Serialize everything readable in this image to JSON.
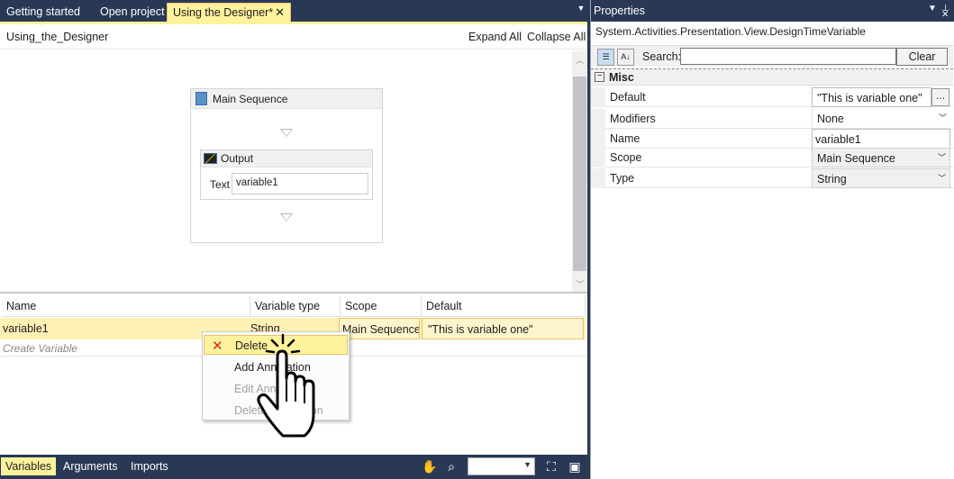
{
  "tabs": [
    {
      "label": "Getting started"
    },
    {
      "label": "Open project"
    },
    {
      "label": "Using the Designer*"
    }
  ],
  "designer": {
    "breadcrumb": "Using_the_Designer",
    "expand_all": "Expand All",
    "collapse_all": "Collapse All",
    "sequence_title": "Main Sequence",
    "output_title": "Output",
    "text_label": "Text",
    "text_value": "variable1"
  },
  "variables_grid": {
    "headers": [
      "Name",
      "Variable type",
      "Scope",
      "Default"
    ],
    "row": {
      "name": "variable1",
      "type": "String",
      "scope": "Main Sequence",
      "default": "\"This is variable one\""
    },
    "create_label": "Create Variable"
  },
  "context_menu": {
    "items": [
      "Delete",
      "Add Annotation",
      "Edit Annotation",
      "Delete Annotation"
    ]
  },
  "bottom_bar": {
    "tabs": [
      "Variables",
      "Arguments",
      "Imports"
    ]
  },
  "properties": {
    "title": "Properties",
    "type_name": "System.Activities.Presentation.View.DesignTimeVariable",
    "search_label": "Search:",
    "clear_label": "Clear",
    "category": "Misc",
    "rows": [
      {
        "name": "Default",
        "value": "\"This is variable one\""
      },
      {
        "name": "Modifiers",
        "value": "None"
      },
      {
        "name": "Name",
        "value": "variable1"
      },
      {
        "name": "Scope",
        "value": "Main Sequence"
      },
      {
        "name": "Type",
        "value": "String"
      }
    ]
  },
  "icons": [
    "dropdown-menu-icon",
    "close-icon",
    "sequence-icon",
    "output-icon",
    "expand-arrow-icon",
    "delete-icon",
    "pan-hand-icon",
    "zoom-search-icon",
    "fit-screen-icon",
    "overview-icon",
    "categorized-icon",
    "alphabetical-icon",
    "pin-icon",
    "hand-pointer-cursor-icon"
  ]
}
